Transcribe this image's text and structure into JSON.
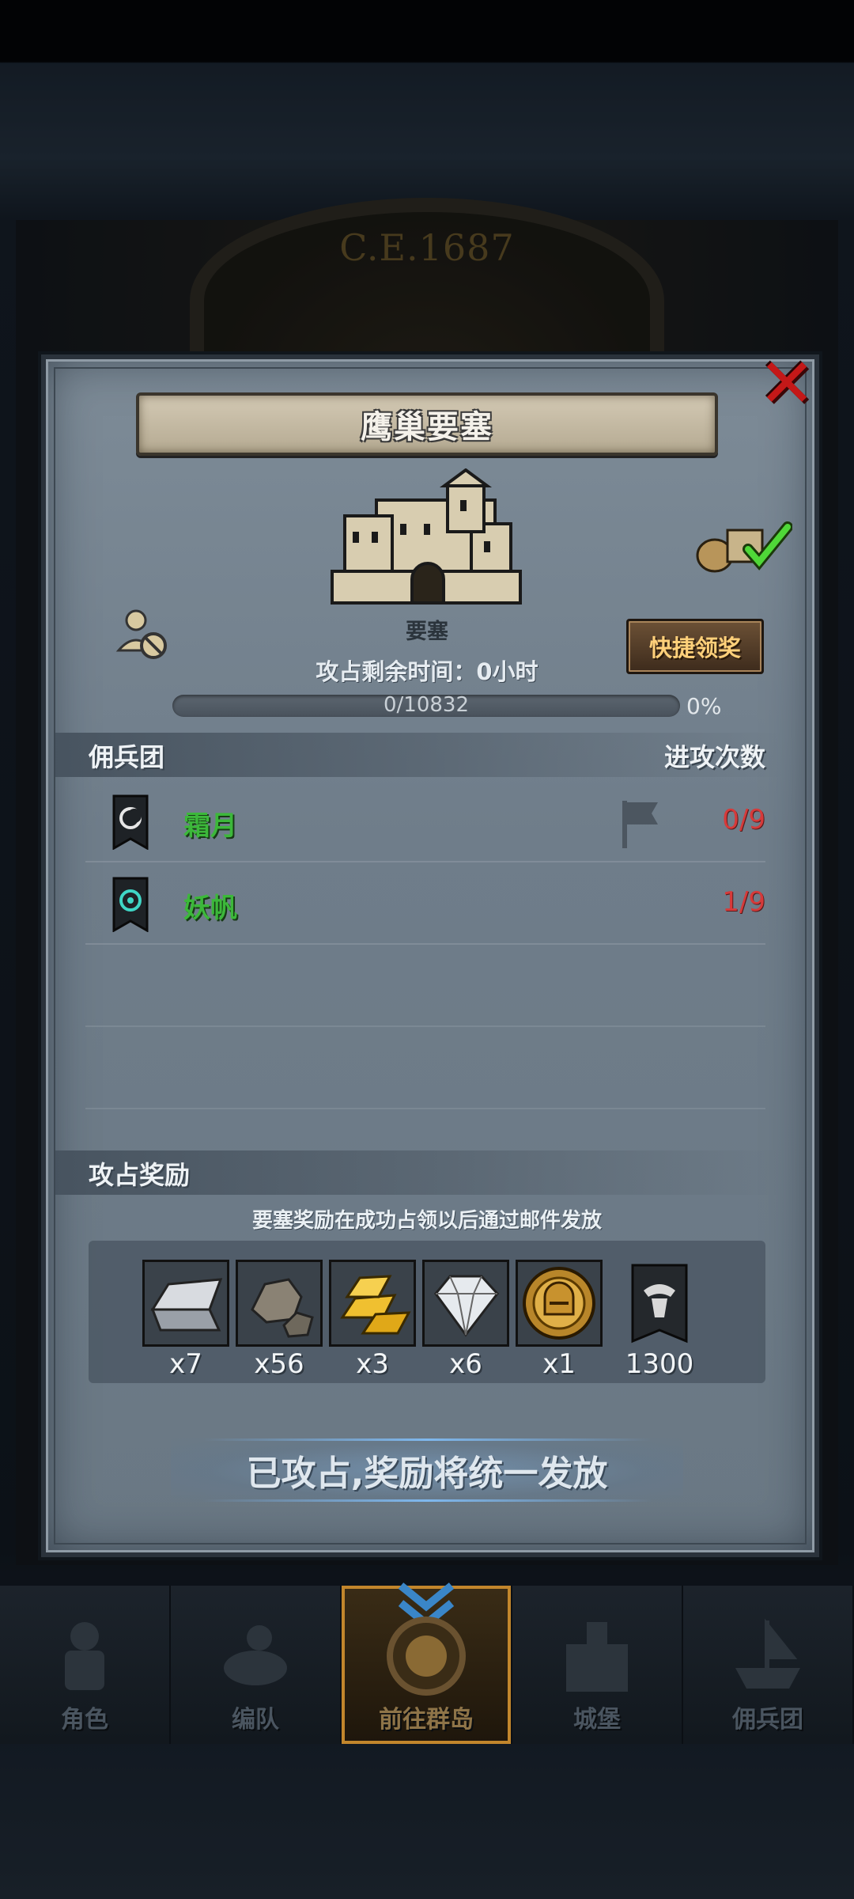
{
  "background": {
    "era_label": "C.E.1687"
  },
  "modal": {
    "title": "鹰巢要塞",
    "building_label": "要塞",
    "quick_claim_label": "快捷领奖",
    "remaining_time": "攻占剩余时间：0小时",
    "progress": {
      "text": "0/10832",
      "percent_label": "0%",
      "fraction": 0
    },
    "mercenary_header": "佣兵团",
    "attack_count_header": "进攻次数",
    "mercenaries": [
      {
        "name": "霜月",
        "count": "0/9"
      },
      {
        "name": "妖帆",
        "count": "1/9"
      }
    ],
    "reward_header": "攻占奖励",
    "reward_note": "要塞奖励在成功占领以后通过邮件发放",
    "rewards": [
      {
        "icon": "silver-ingot-icon",
        "count": "x7"
      },
      {
        "icon": "ore-stone-icon",
        "count": "x56"
      },
      {
        "icon": "gold-bars-icon",
        "count": "x3"
      },
      {
        "icon": "diamond-icon",
        "count": "x6"
      },
      {
        "icon": "knight-helmet-coin-icon",
        "count": "x1"
      },
      {
        "icon": "bull-banner-icon",
        "count": "1300"
      }
    ],
    "status": "已攻占,奖励将统一发放"
  },
  "nav": {
    "items": [
      {
        "label": "角色"
      },
      {
        "label": "编队"
      },
      {
        "label": "前往群岛"
      },
      {
        "label": "城堡"
      },
      {
        "label": "佣兵团"
      }
    ]
  },
  "colors": {
    "mercenary_name": "#3cb83a",
    "attack_count": "#d63a3a",
    "close": "#c41818",
    "quick_claim_text": "#ffd07a",
    "nav_active_border": "#c2862c"
  }
}
